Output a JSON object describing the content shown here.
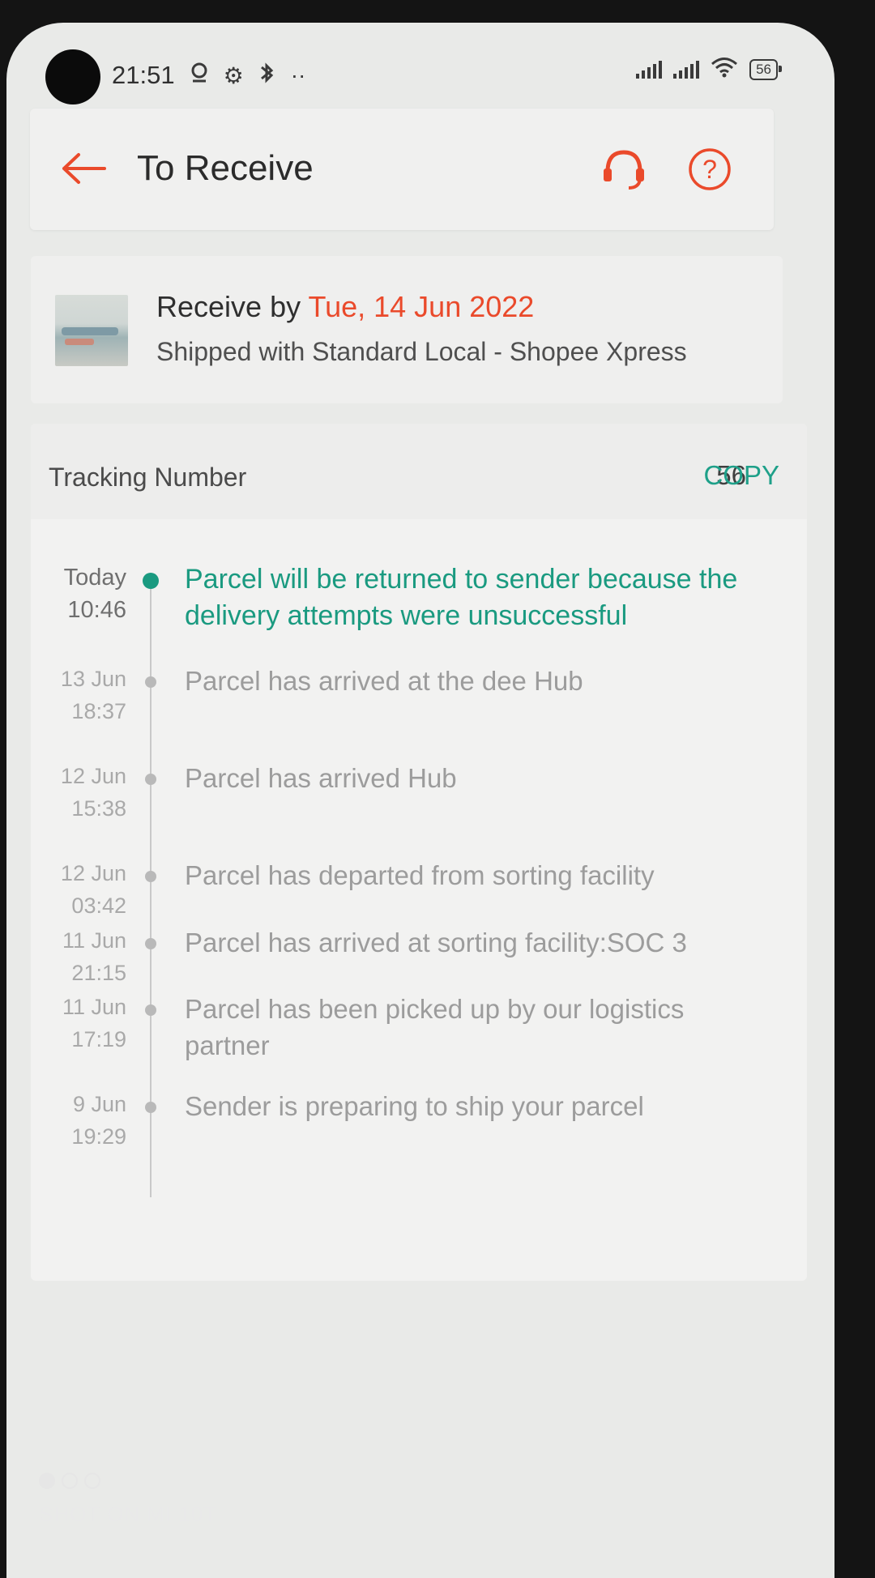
{
  "status_bar": {
    "time": "21:51",
    "battery": "56",
    "icons": [
      "location-icon",
      "gear-icon",
      "bluetooth-icon",
      "more-dots-icon",
      "signal-icon",
      "wifi-icon",
      "battery-icon"
    ]
  },
  "header": {
    "title": "To Receive",
    "accent_color": "#ea4a2b"
  },
  "delivery": {
    "receive_prefix": "Receive by ",
    "receive_date": "Tue, 14 Jun 2022",
    "shipped": "Shipped with Standard Local - Shopee Xpress"
  },
  "tracking": {
    "label": "Tracking Number",
    "number": "56",
    "copy_label": "COPY",
    "events": [
      {
        "date": "Today",
        "time": "10:46",
        "text": "Parcel will be returned to sender because the delivery attempts were unsuccessful",
        "current": true
      },
      {
        "date": "13 Jun",
        "time": "18:37",
        "text": "Parcel has arrived at the dee Hub"
      },
      {
        "date": "12 Jun",
        "time": "15:38",
        "text": "Parcel has arrived Hub"
      },
      {
        "date": "12 Jun",
        "time": "03:42",
        "text": "Parcel has departed from sorting facility"
      },
      {
        "date": "11 Jun",
        "time": "21:15",
        "text": "Parcel has arrived at sorting facility:SOC 3"
      },
      {
        "date": "11 Jun",
        "time": "17:19",
        "text": "Parcel has been picked up by our logistics partner"
      },
      {
        "date": "9 Jun",
        "time": "19:29",
        "text": "Sender is preparing to ship your parcel"
      }
    ]
  },
  "watermark": "SHOT ON MI 10T"
}
